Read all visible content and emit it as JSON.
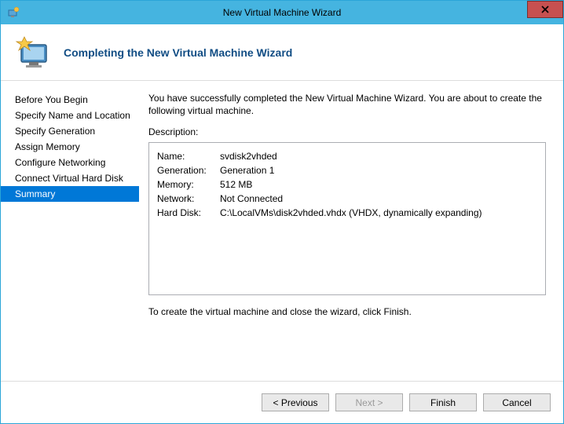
{
  "window": {
    "title": "New Virtual Machine Wizard"
  },
  "header": {
    "title": "Completing the New Virtual Machine Wizard"
  },
  "sidebar": {
    "items": [
      {
        "label": "Before You Begin"
      },
      {
        "label": "Specify Name and Location"
      },
      {
        "label": "Specify Generation"
      },
      {
        "label": "Assign Memory"
      },
      {
        "label": "Configure Networking"
      },
      {
        "label": "Connect Virtual Hard Disk"
      },
      {
        "label": "Summary"
      }
    ]
  },
  "main": {
    "intro": "You have successfully completed the New Virtual Machine Wizard. You are about to create the following virtual machine.",
    "description_label": "Description:",
    "details": {
      "name_key": "Name:",
      "name_val": "svdisk2vhded",
      "generation_key": "Generation:",
      "generation_val": "Generation 1",
      "memory_key": "Memory:",
      "memory_val": "512 MB",
      "network_key": "Network:",
      "network_val": "Not Connected",
      "harddisk_key": "Hard Disk:",
      "harddisk_val": "C:\\LocalVMs\\disk2vhded.vhdx (VHDX, dynamically expanding)"
    },
    "outro": "To create the virtual machine and close the wizard, click Finish."
  },
  "footer": {
    "previous": "< Previous",
    "next": "Next >",
    "finish": "Finish",
    "cancel": "Cancel"
  }
}
